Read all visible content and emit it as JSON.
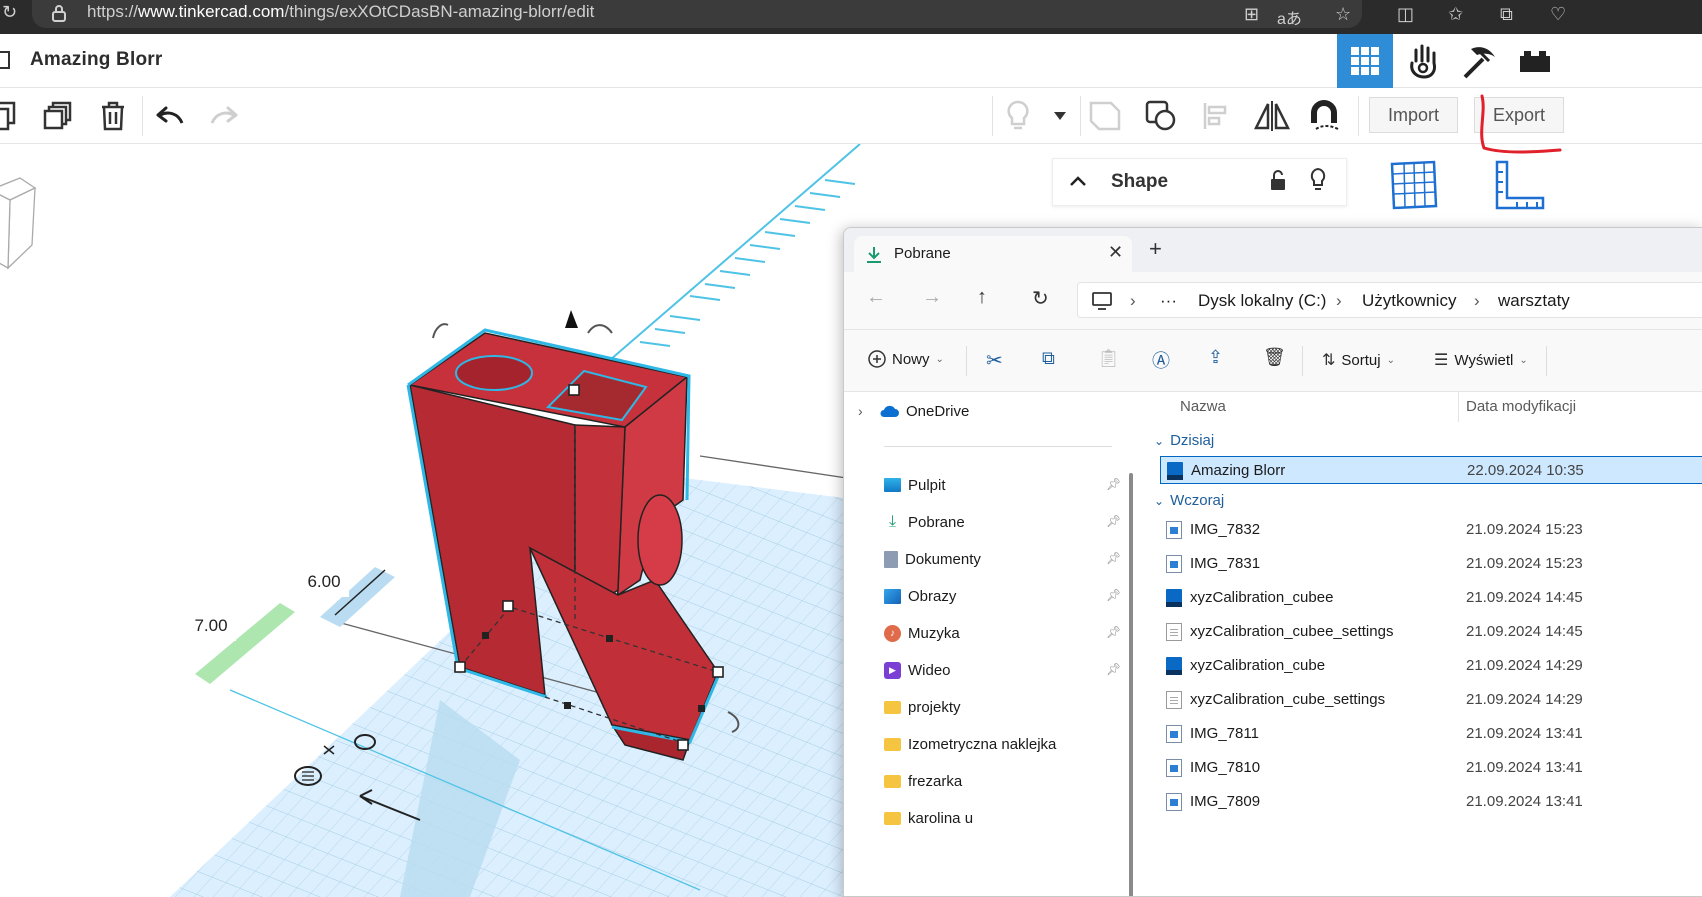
{
  "browser": {
    "url_prefix": "https://",
    "url_domain": "www.tinkercad.com",
    "url_path": "/things/exXOtCDasBN-amazing-blorr/edit"
  },
  "tinkercad": {
    "title": "Amazing Blorr",
    "import_label": "Import",
    "export_label": "Export",
    "shape_panel_title": "Shape",
    "dimension_a": "6.00",
    "dimension_b": "7.00"
  },
  "explorer": {
    "tab_title": "Pobrane",
    "breadcrumbs": [
      "Dysk lokalny (C:)",
      "Użytkownicy",
      "warsztaty"
    ],
    "commands": {
      "new": "Nowy",
      "sort": "Sortuj",
      "view": "Wyświetl"
    },
    "nav": {
      "onedrive": "OneDrive",
      "quick_access": [
        {
          "label": "Pulpit",
          "icon": "desktop-icon"
        },
        {
          "label": "Pobrane",
          "icon": "download-icon"
        },
        {
          "label": "Dokumenty",
          "icon": "documents-icon"
        },
        {
          "label": "Obrazy",
          "icon": "pictures-icon"
        },
        {
          "label": "Muzyka",
          "icon": "music-icon"
        },
        {
          "label": "Wideo",
          "icon": "video-icon"
        }
      ],
      "folders": [
        "projekty",
        "Izometryczna naklejka",
        "frezarka",
        "karolina u"
      ]
    },
    "columns": {
      "name": "Nazwa",
      "date": "Data modyfikacji"
    },
    "groups": [
      {
        "label": "Dzisiaj",
        "files": [
          {
            "name": "Amazing Blorr",
            "date": "22.09.2024 10:35",
            "type": "stl",
            "selected": true
          }
        ]
      },
      {
        "label": "Wczoraj",
        "files": [
          {
            "name": "IMG_7832",
            "date": "21.09.2024 15:23",
            "type": "img"
          },
          {
            "name": "IMG_7831",
            "date": "21.09.2024 15:23",
            "type": "img"
          },
          {
            "name": "xyzCalibration_cubee",
            "date": "21.09.2024 14:45",
            "type": "stl"
          },
          {
            "name": "xyzCalibration_cubee_settings",
            "date": "21.09.2024 14:45",
            "type": "txt"
          },
          {
            "name": "xyzCalibration_cube",
            "date": "21.09.2024 14:29",
            "type": "stl"
          },
          {
            "name": "xyzCalibration_cube_settings",
            "date": "21.09.2024 14:29",
            "type": "txt"
          },
          {
            "name": "IMG_7811",
            "date": "21.09.2024 13:41",
            "type": "img"
          },
          {
            "name": "IMG_7810",
            "date": "21.09.2024 13:41",
            "type": "img"
          },
          {
            "name": "IMG_7809",
            "date": "21.09.2024 13:41",
            "type": "img"
          }
        ]
      }
    ]
  },
  "colors": {
    "accent": "#2f8cd6",
    "shape_red": "#c7313b",
    "selection_cyan": "#2fb7e6",
    "annotation_red": "#e0202a"
  }
}
